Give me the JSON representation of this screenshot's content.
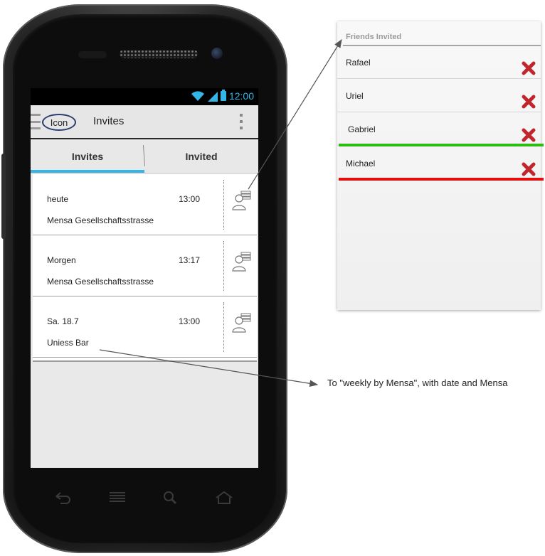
{
  "status_bar": {
    "time": "12:00"
  },
  "action_bar": {
    "icon_label": "Icon",
    "title": "Invites"
  },
  "tabs": [
    {
      "label": "Invites",
      "active": true
    },
    {
      "label": "Invited",
      "active": false
    }
  ],
  "invites": [
    {
      "date": "heute",
      "time": "13:00",
      "place": "Mensa Gesellschaftsstrasse"
    },
    {
      "date": "Morgen",
      "time": "13:17",
      "place": "Mensa Gesellschaftsstrasse"
    },
    {
      "date": "Sa. 18.7",
      "time": "13:00",
      "place": "Uniess Bar"
    }
  ],
  "friends_panel": {
    "title": "Friends Invited",
    "friends": [
      {
        "name": "Rafael",
        "status": "none"
      },
      {
        "name": "Uriel",
        "status": "none"
      },
      {
        "name": "Gabriel",
        "status": "accepted",
        "status_color": "#2fbb15"
      },
      {
        "name": "Michael",
        "status": "declined",
        "status_color": "#e20d0d"
      }
    ]
  },
  "annotation": {
    "text": "To \"weekly by Mensa\", with date and Mensa"
  },
  "colors": {
    "accent": "#33b5e5",
    "accepted": "#2fbb15",
    "declined": "#e20d0d"
  },
  "icons": {
    "status": [
      "wifi-icon",
      "signal-icon",
      "battery-icon"
    ],
    "navigation": [
      "back-icon",
      "menu-icon",
      "search-icon",
      "home-icon"
    ],
    "row_action": "invite-friends-icon",
    "friend_action": "remove-icon"
  }
}
